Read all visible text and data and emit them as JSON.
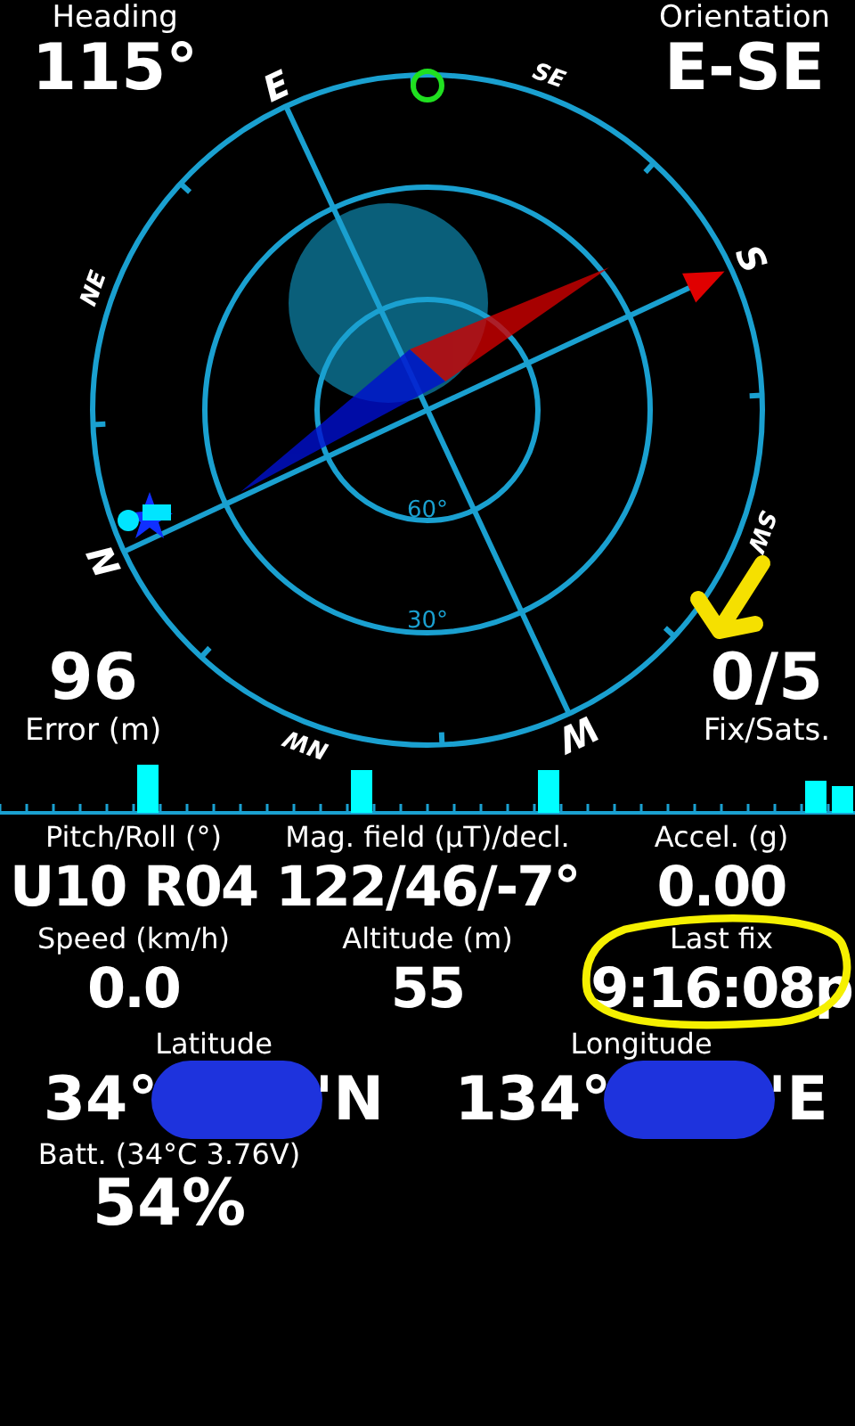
{
  "heading": {
    "label": "Heading",
    "value": "115°"
  },
  "orientation": {
    "label": "Orientation",
    "value": "E-SE"
  },
  "compass": {
    "directions": [
      "N",
      "NE",
      "E",
      "SE",
      "S",
      "SW",
      "W",
      "NW"
    ],
    "ring_labels": [
      "60°",
      "30°"
    ]
  },
  "error": {
    "value": "96",
    "label": "Error (m)"
  },
  "fix_sats": {
    "value": "0/5",
    "label": "Fix/Sats."
  },
  "readings": [
    {
      "label": "Pitch/Roll (°)",
      "value": "U10 R04",
      "circled": false
    },
    {
      "label": "Mag. field (µT)/decl.",
      "value": "122/46/-7°",
      "circled": false
    },
    {
      "label": "Accel. (g)",
      "value": "0.00",
      "circled": false
    },
    {
      "label": "Speed (km/h)",
      "value": "0.0",
      "circled": false
    },
    {
      "label": "Altitude (m)",
      "value": "55",
      "circled": false
    },
    {
      "label": "Last fix",
      "value": "9:16:08p",
      "circled": true
    }
  ],
  "position": [
    {
      "label": "Latitude",
      "value_start": "34°",
      "value_end": "'N",
      "redacted": true
    },
    {
      "label": "Longitude",
      "value_start": "134°",
      "value_end": "'E",
      "redacted": true
    }
  ],
  "battery": {
    "label": "Batt. (34°C 3.76V)",
    "value": "54%"
  }
}
